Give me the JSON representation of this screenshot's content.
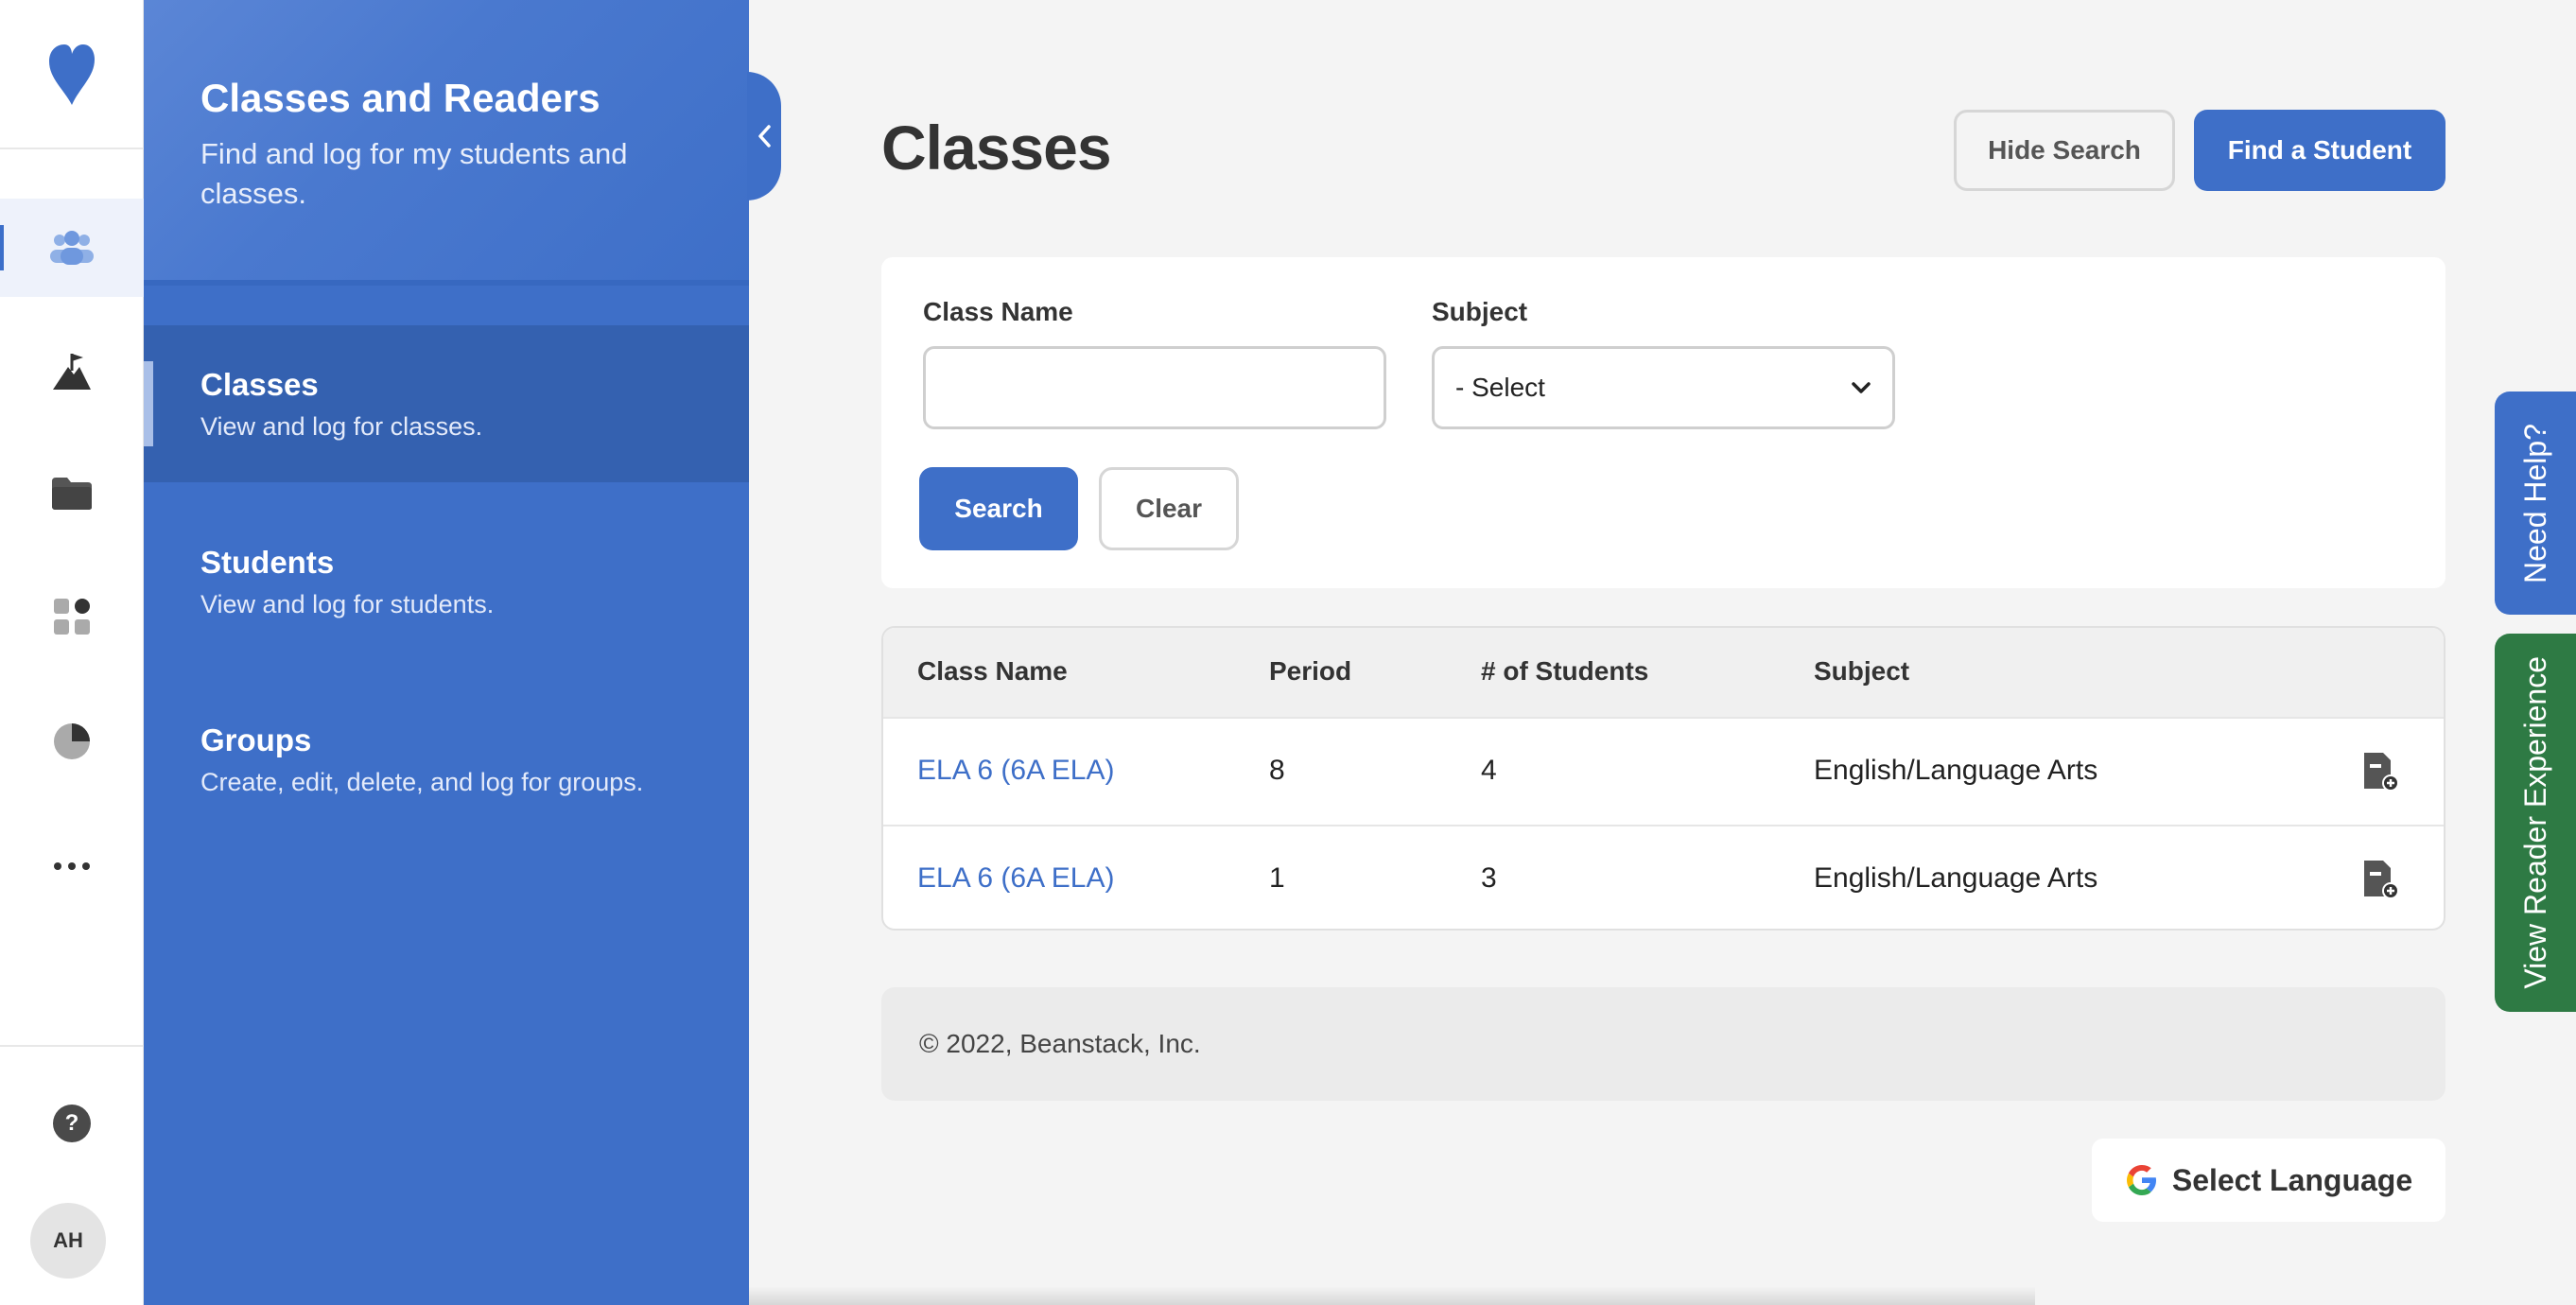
{
  "rail": {
    "avatar_initials": "AH",
    "help_glyph": "?",
    "items": [
      {
        "icon": "users-icon",
        "active": true
      },
      {
        "icon": "mountain-flag-icon",
        "active": false
      },
      {
        "icon": "folder-icon",
        "active": false
      },
      {
        "icon": "apps-grid-icon",
        "active": false
      },
      {
        "icon": "pie-chart-icon",
        "active": false
      },
      {
        "icon": "more-icon",
        "active": false
      }
    ]
  },
  "sidebar": {
    "title": "Classes and Readers",
    "subtitle": "Find and log for my students and classes.",
    "items": [
      {
        "label": "Classes",
        "desc": "View and log for classes."
      },
      {
        "label": "Students",
        "desc": "View and log for students."
      },
      {
        "label": "Groups",
        "desc": "Create, edit, delete, and log for groups."
      }
    ]
  },
  "main": {
    "title": "Classes",
    "hide_search_label": "Hide Search",
    "find_student_label": "Find a Student"
  },
  "search": {
    "class_name_label": "Class Name",
    "class_name_value": "",
    "subject_label": "Subject",
    "subject_selected": "- Select",
    "search_label": "Search",
    "clear_label": "Clear"
  },
  "table": {
    "headers": [
      "Class Name",
      "Period",
      "# of Students",
      "Subject"
    ],
    "rows": [
      {
        "class_name": "ELA 6 (6A ELA)",
        "period": "8",
        "students": "4",
        "subject": "English/Language Arts"
      },
      {
        "class_name": "ELA 6 (6A ELA)",
        "period": "1",
        "students": "3",
        "subject": "English/Language Arts"
      }
    ]
  },
  "footer": {
    "copyright": "© 2022, Beanstack, Inc."
  },
  "language": {
    "label": "Select Language"
  },
  "side_tabs": {
    "help": "Need Help?",
    "reader": "View Reader Experience"
  },
  "colors": {
    "primary": "#3e6fc8",
    "sidebar_active": "#3461b0",
    "reader_tab": "#2e7a44",
    "link": "#3e6fc8"
  }
}
